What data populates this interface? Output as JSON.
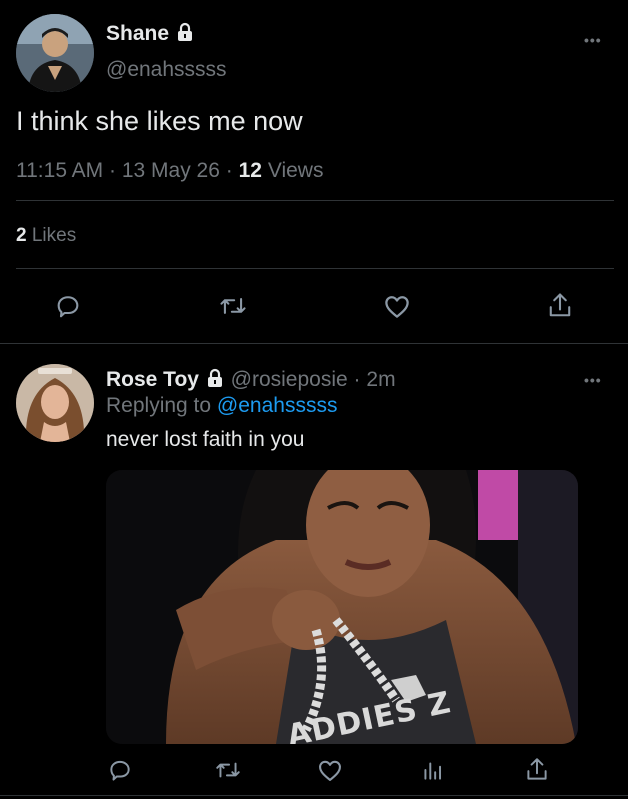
{
  "main_tweet": {
    "author_name": "Shane",
    "handle": "@enahsssss",
    "text": "I think she likes me now",
    "time": "11:15 AM",
    "date": "13 May 26",
    "views_count": "12",
    "views_label": "Views",
    "likes_count": "2",
    "likes_label": "Likes",
    "separator": "·"
  },
  "reply": {
    "author_name": "Rose Toy",
    "handle": "@rosieposie",
    "age": "2m",
    "replying_to_label": "Replying to",
    "replying_to_handle": "@enahsssss",
    "text": "never lost faith in you",
    "separator": "·",
    "media_overlay_text": "ADDIES Z"
  },
  "more_label": "•••",
  "colors": {
    "background": "#000000",
    "text": "#e7e9ea",
    "muted": "#71767b",
    "link": "#1d9bf0",
    "divider": "#2f3336"
  },
  "icons": {
    "reply": "reply-icon",
    "retweet": "retweet-icon",
    "like": "heart-icon",
    "share": "share-icon",
    "analytics": "analytics-icon",
    "lock": "lock-icon",
    "more": "more-icon"
  }
}
